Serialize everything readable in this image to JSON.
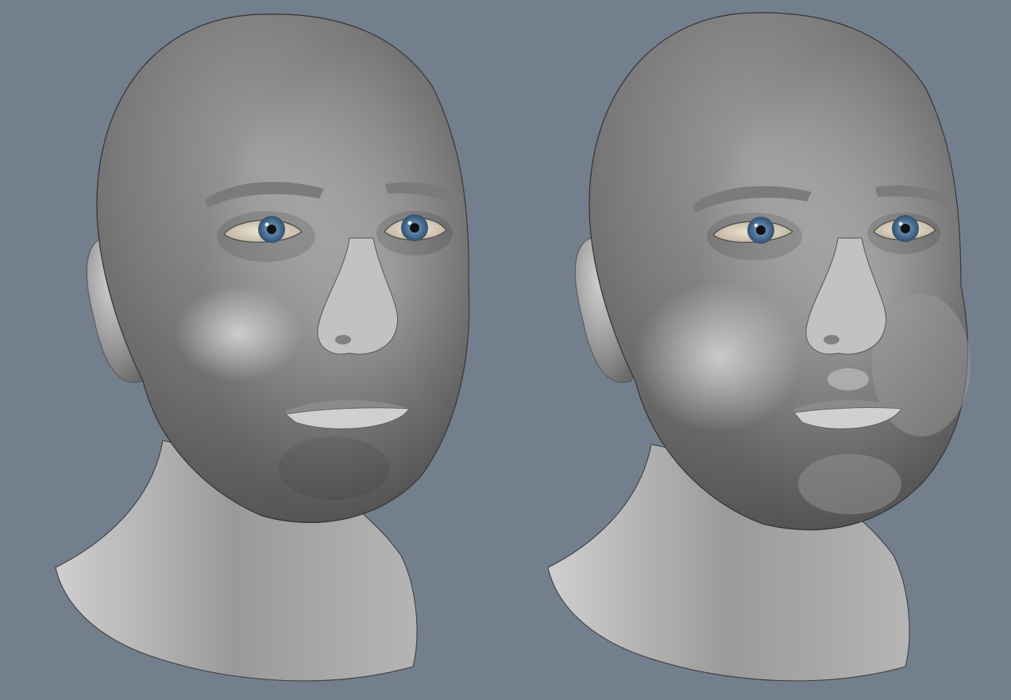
{
  "scene": {
    "background_color": "#737f8d",
    "skin_color": "#a9a9a9",
    "iris_color": "#5f88b0",
    "figures": [
      {
        "name": "head-neutral",
        "expression": "neutral"
      },
      {
        "name": "head-puffed-cheeks",
        "expression": "puffed cheeks"
      }
    ]
  }
}
